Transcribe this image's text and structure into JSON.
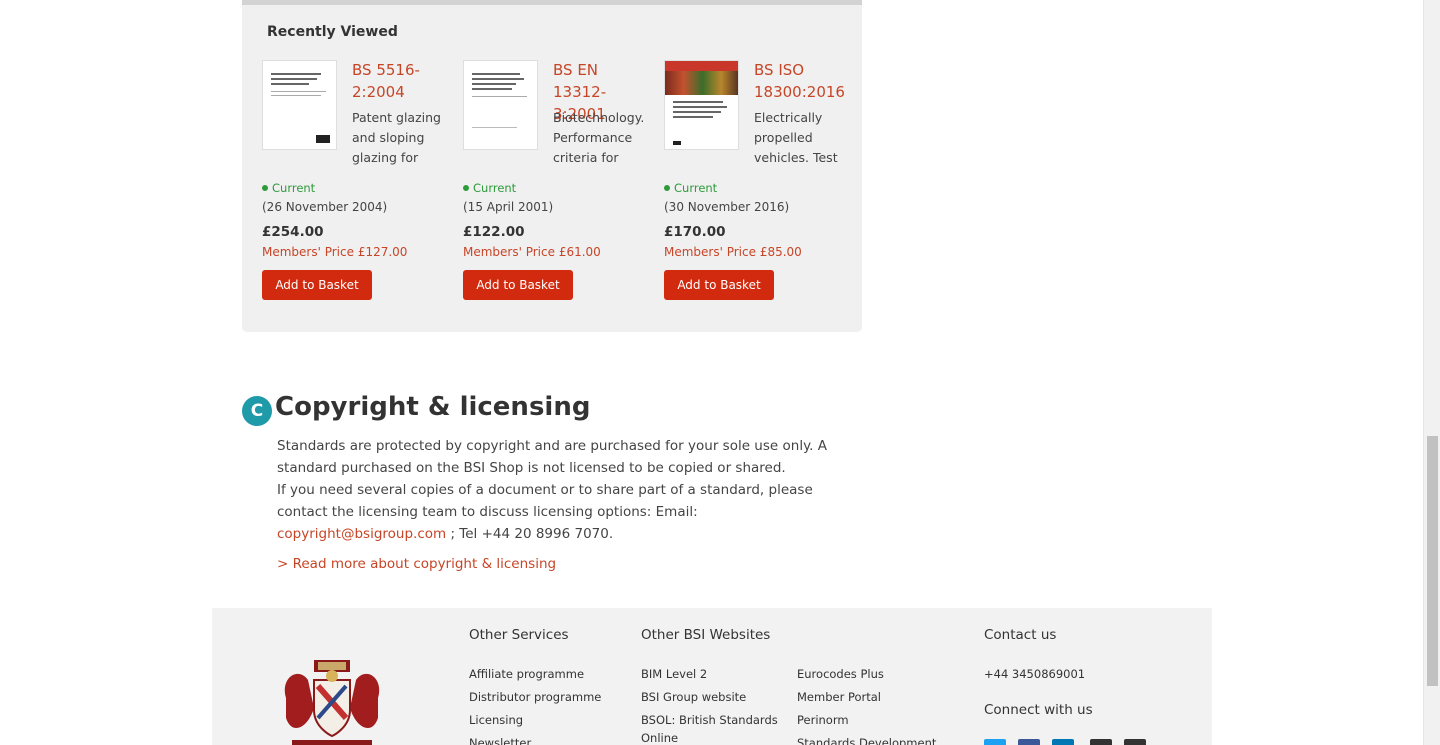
{
  "recently_viewed": {
    "title": "Recently Viewed",
    "items": [
      {
        "code": "BS 5516-2:2004",
        "description": "Patent glazing and sloping glazing for",
        "status": "Current",
        "date": "(26 November 2004)",
        "price": "£254.00",
        "members_price": "Members' Price £127.00",
        "button": "Add to Basket"
      },
      {
        "code": "BS EN 13312-3:2001",
        "description": "Biotechnology. Performance criteria for piping",
        "status": "Current",
        "date": "(15 April 2001)",
        "price": "£122.00",
        "members_price": "Members' Price £61.00",
        "button": "Add to Basket"
      },
      {
        "code": "BS ISO 18300:2016",
        "description": "Electrically propelled vehicles. Test",
        "status": "Current",
        "date": "(30 November 2016)",
        "price": "£170.00",
        "members_price": "Members' Price £85.00",
        "button": "Add to Basket"
      }
    ]
  },
  "copyright": {
    "badge": "C",
    "title": "Copyright & licensing",
    "para1": "Standards are protected by copyright and are purchased for your sole use only. A standard purchased on the BSI Shop is not licensed to be copied or shared.",
    "para2_start": "If you need several copies of a document or to share part of a standard, please contact the licensing team to discuss licensing options: Email: ",
    "email": "copyright@bsigroup.com",
    "para2_end": " ; Tel +44 20 8996 7070.",
    "read_more": "> Read more about copyright & licensing"
  },
  "footer": {
    "other_services": {
      "heading": "Other Services",
      "links": [
        "Affiliate programme",
        "Distributor programme",
        "Licensing",
        "Newsletter"
      ]
    },
    "other_websites": {
      "heading": "Other BSI Websites",
      "col1": [
        "BIM Level 2",
        "BSI Group website",
        "BSOL: British Standards Online"
      ],
      "col2": [
        "Eurocodes Plus",
        "Member Portal",
        "Perinorm",
        "Standards Development"
      ]
    },
    "contact": {
      "heading": "Contact us",
      "phone": "+44 3450869001",
      "connect": "Connect with us",
      "social_icons": [
        "twitter-icon",
        "facebook-icon",
        "linkedin-icon",
        "email-icon",
        "print-icon"
      ]
    }
  },
  "colors": {
    "accent": "#c74527",
    "button": "#d12a0f",
    "status_green": "#2e9b3b",
    "badge_teal": "#1f9aa8"
  }
}
